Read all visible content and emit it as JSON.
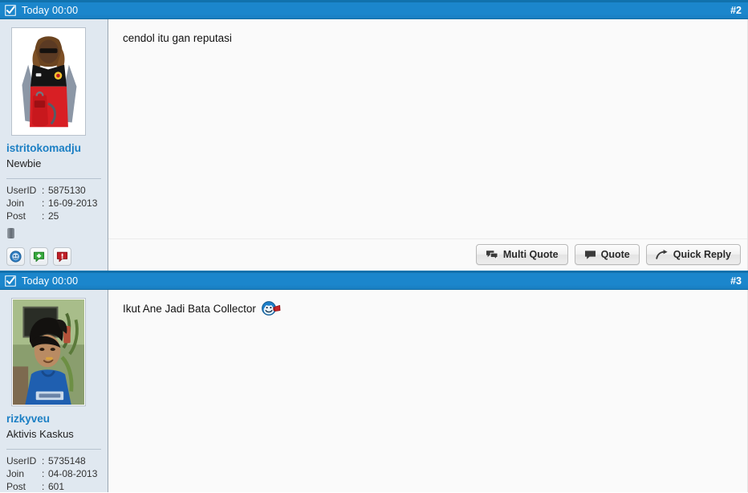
{
  "forum": {
    "posts": [
      {
        "header": {
          "checkbox_icon": "checkbox-checked-icon",
          "date": "Today 00:00",
          "post_number": "#2"
        },
        "user": {
          "avatar_icon": "avatar-image",
          "avatar_alt": "Person wearing red and black Manchester United jacket with sunglasses",
          "username": "istritokomadju",
          "usertitle": "Newbie",
          "stats": [
            {
              "key": "UserID",
              "colon": ":",
              "value": "5875130"
            },
            {
              "key": "Join",
              "colon": ":",
              "value": "16-09-2013"
            },
            {
              "key": "Post",
              "colon": ":",
              "value": "25"
            }
          ],
          "status_icon": "offline-status-icon",
          "reputation_buttons": [
            {
              "name": "view-profile-icon",
              "color": "#2f7fc4"
            },
            {
              "name": "give-reputation-icon",
              "color": "#36a83c"
            },
            {
              "name": "report-post-icon",
              "color": "#c01f27"
            }
          ]
        },
        "message": {
          "text": "cendol itu gan reputasi",
          "smiley": null
        },
        "actions": [
          {
            "label": "Multi Quote",
            "icon": "multi-quote-icon"
          },
          {
            "label": "Quote",
            "icon": "quote-icon"
          },
          {
            "label": "Quick Reply",
            "icon": "quick-reply-arrow-icon"
          }
        ]
      },
      {
        "header": {
          "checkbox_icon": "checkbox-checked-icon",
          "date": "Today 00:00",
          "post_number": "#3"
        },
        "user": {
          "avatar_icon": "avatar-image",
          "avatar_alt": "Young man with black hair in blue t-shirt in front of green wall and plants",
          "username": "rizkyveu",
          "usertitle": "Aktivis Kaskus",
          "stats": [
            {
              "key": "UserID",
              "colon": ":",
              "value": "5735148"
            },
            {
              "key": "Join",
              "colon": ":",
              "value": "04-08-2013"
            },
            {
              "key": "Post",
              "colon": ":",
              "value": "601"
            }
          ],
          "status_icon": null,
          "reputation_buttons": []
        },
        "message": {
          "text": "Ikut Ane Jadi Bata Collector",
          "smiley": "blue-smiley-with-brick-emoticon"
        },
        "actions": []
      }
    ]
  },
  "colors": {
    "header_blue": "#1b86cc",
    "header_blue_dark": "#1171ac",
    "sidebar_bg": "#e0e8f0",
    "content_bg": "#fafafa",
    "username_link": "#1b7fc4"
  }
}
